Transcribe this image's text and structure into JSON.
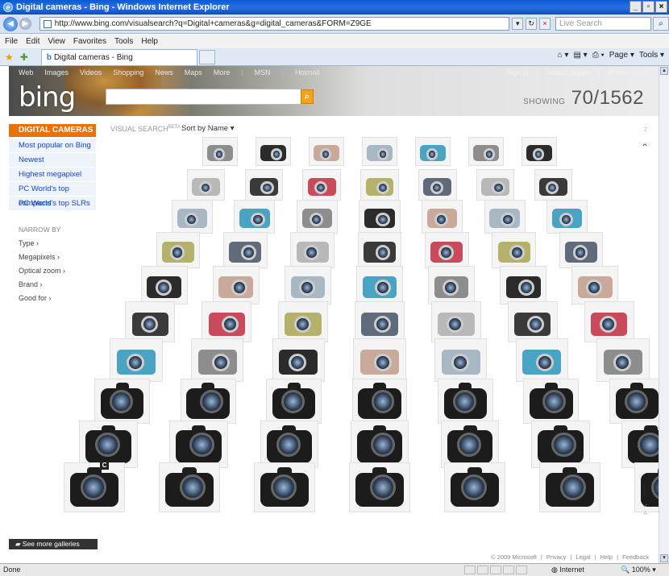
{
  "browser": {
    "title": "Digital cameras - Bing - Windows Internet Explorer",
    "url": "http://www.bing.com/visualsearch?q=Digital+cameras&g=digital_cameras&FORM=Z9GE",
    "search_placeholder": "Live Search",
    "menu": [
      "File",
      "Edit",
      "View",
      "Favorites",
      "Tools",
      "Help"
    ],
    "tab_label": "Digital cameras - Bing",
    "commands": [
      "Page ▾",
      "Tools ▾"
    ],
    "status": "Done",
    "zone": "Internet",
    "zoom": "100%"
  },
  "bing": {
    "nav": [
      "Web",
      "Images",
      "Videos",
      "Shopping",
      "News",
      "Maps",
      "More",
      "MSN",
      "Hotmail"
    ],
    "top_right": [
      "Sign in",
      "United States",
      "Preferences"
    ],
    "logo": "bing",
    "showing_label": "SHOWING",
    "showing_count": "70/1562",
    "category": "DIGITAL CAMERAS",
    "links": [
      "Most popular on Bing",
      "Newest",
      "Highest megapixel",
      "PC World's top compacts",
      "PC World's top SLRs"
    ],
    "narrow_by": "NARROW BY",
    "filters": [
      "Type ›",
      "Megapixels ›",
      "Optical zoom ›",
      "Brand ›",
      "Good for ›"
    ],
    "visual_search": "VISUAL SEARCH",
    "beta": "BETA",
    "sort": "Sort by Name ▾",
    "scroll_top": "Z",
    "scroll_bottom": "A",
    "section_mark": "C",
    "galleries": "See more galleries",
    "footer": [
      "© 2009 Microsoft",
      "Privacy",
      "Legal",
      "Help",
      "Feedback"
    ]
  },
  "gallery": {
    "rows_count": 10,
    "cols_count": 7,
    "colors": [
      "#8d8d8d",
      "#5f6b7a",
      "#2b2b2b",
      "#b8b8b8",
      "#c9a99a",
      "#3a3a3a",
      "#a7b8c4",
      "#c94a5a",
      "#49a3c2",
      "#b5b06a"
    ]
  }
}
